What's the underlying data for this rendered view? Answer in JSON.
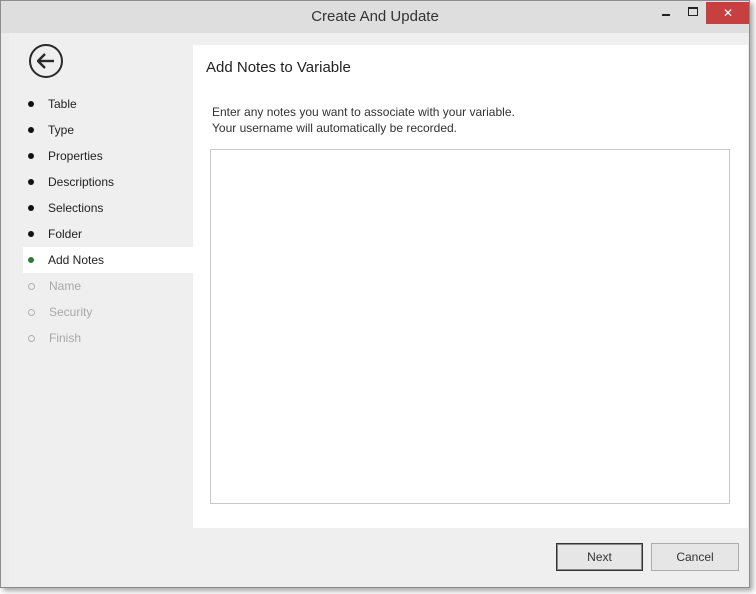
{
  "window": {
    "title": "Create And Update",
    "close_glyph": "✕"
  },
  "sidebar": {
    "items": [
      {
        "label": "Table",
        "state": "completed"
      },
      {
        "label": "Type",
        "state": "completed"
      },
      {
        "label": "Properties",
        "state": "completed"
      },
      {
        "label": "Descriptions",
        "state": "completed"
      },
      {
        "label": "Selections",
        "state": "completed"
      },
      {
        "label": "Folder",
        "state": "completed"
      },
      {
        "label": "Add Notes",
        "state": "active"
      },
      {
        "label": "Name",
        "state": "disabled"
      },
      {
        "label": "Security",
        "state": "disabled"
      },
      {
        "label": "Finish",
        "state": "disabled"
      }
    ]
  },
  "main": {
    "heading": "Add Notes to Variable",
    "instruction_line1": "Enter any notes you want to associate with your variable.",
    "instruction_line2": "Your username will automatically be recorded.",
    "notes_value": ""
  },
  "footer": {
    "next_label": "Next",
    "cancel_label": "Cancel"
  },
  "colors": {
    "active_dot": "#2e7d32",
    "close_button": "#c74040"
  },
  "icons": {
    "back": "back-arrow-icon",
    "minimize": "minimize-icon",
    "maximize": "maximize-icon",
    "close": "close-icon"
  }
}
